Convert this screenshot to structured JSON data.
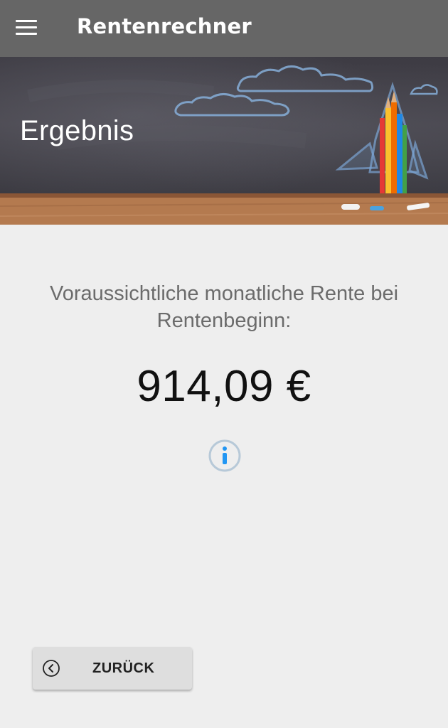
{
  "toolbar": {
    "title": "Rentenrechner",
    "menu_icon": "hamburger-menu-icon"
  },
  "hero": {
    "title": "Ergebnis",
    "image": "chalkboard-with-rocket-and-pencils"
  },
  "result": {
    "label": "Voraussichtliche monatliche Rente bei Rentenbeginn:",
    "value": "914,09 €",
    "info_icon": "info-icon"
  },
  "actions": {
    "back_label": "ZURÜCK",
    "back_icon": "chevron-left-circle-icon"
  },
  "colors": {
    "toolbar": "#666666",
    "background": "#eeeeee",
    "info_accent": "#2196f3",
    "button": "#dedede"
  }
}
